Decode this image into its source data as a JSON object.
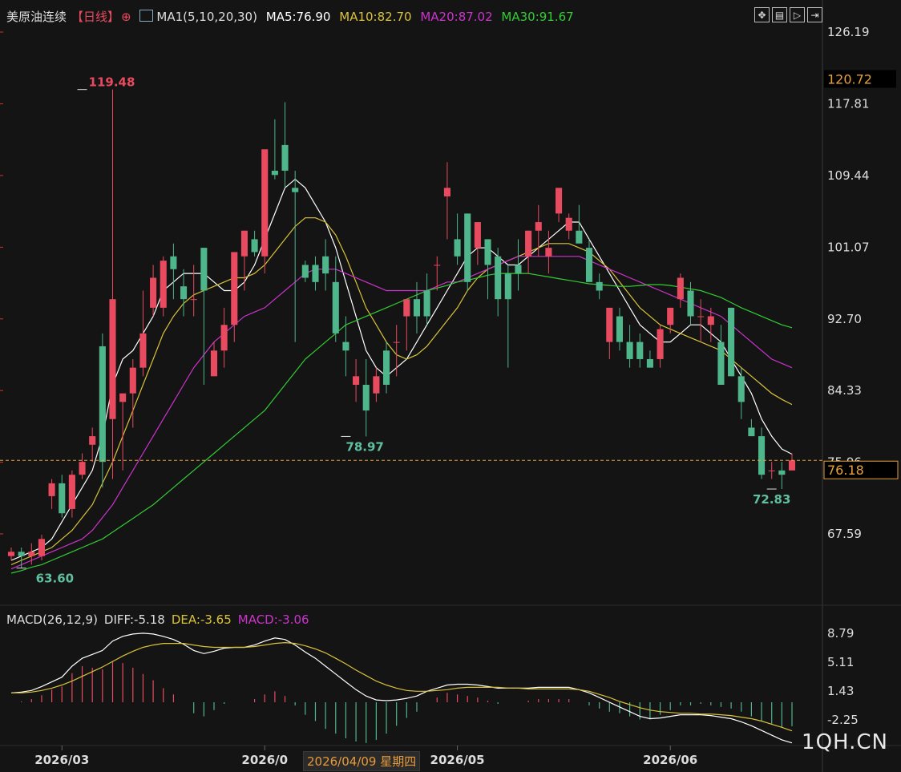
{
  "header": {
    "symbol": "美原油连续",
    "period": "【日线】",
    "ma_label": "MA1(5,10,20,30)",
    "ma5": "MA5:76.90",
    "ma10": "MA10:82.70",
    "ma20": "MA20:87.02",
    "ma30": "MA30:91.67"
  },
  "colors": {
    "background": "#141414",
    "up": "#e84a5f",
    "down": "#4fb58a",
    "ma5": "#ffffff",
    "ma10": "#d9c23a",
    "ma20": "#cc33cc",
    "ma30": "#33cc33",
    "last_price": "#e6a23c"
  },
  "toolbar_icons": [
    "expand-icon",
    "grid-icon",
    "play-icon",
    "next-icon"
  ],
  "macd_header": {
    "label": "MACD(26,12,9)",
    "diff": "DIFF:-5.18",
    "dea": "DEA:-3.65",
    "macd": "MACD:-3.06"
  },
  "cursor_date": "2026/04/09 星期四",
  "watermark": "1QH.CN",
  "chart_data": [
    {
      "type": "candlestick",
      "title": "美原油连续",
      "y_ticks": [
        126.19,
        117.81,
        109.44,
        101.07,
        92.7,
        84.33,
        75.96,
        67.59
      ],
      "ylim": [
        62,
        127
      ],
      "highlighted_prices": {
        "high_marker": "120.72",
        "last_price": "76.18"
      },
      "annotations": [
        {
          "label": "119.48",
          "value": 119.48,
          "index": 7,
          "kind": "high"
        },
        {
          "label": "78.97",
          "value": 78.97,
          "index": 33,
          "kind": "low"
        },
        {
          "label": "63.60",
          "value": 63.6,
          "index": 1,
          "kind": "low"
        },
        {
          "label": "72.83",
          "value": 72.83,
          "index": 75,
          "kind": "low"
        }
      ],
      "x_labels": [
        {
          "label": "2026/03",
          "index": 5
        },
        {
          "label": "2026/0",
          "index": 25
        },
        {
          "label": "2026/05",
          "index": 44
        },
        {
          "label": "2026/06",
          "index": 65
        }
      ],
      "candles": [
        [
          65,
          66,
          64.5,
          65.5
        ],
        [
          65.5,
          66,
          63.6,
          65
        ],
        [
          65,
          66.5,
          64,
          65.5
        ],
        [
          65,
          67.5,
          64.5,
          67
        ],
        [
          72,
          74,
          70.5,
          73.5
        ],
        [
          73.5,
          74.5,
          69.5,
          70
        ],
        [
          70.5,
          75,
          69.5,
          74.5
        ],
        [
          74.5,
          77,
          74,
          76
        ],
        [
          78,
          80,
          76,
          79
        ],
        [
          89.5,
          91,
          73,
          76
        ],
        [
          81,
          119.48,
          74,
          95
        ],
        [
          83,
          83.5,
          75,
          84
        ],
        [
          84,
          88,
          80,
          87
        ],
        [
          87,
          96,
          86,
          91
        ],
        [
          94,
          99,
          93,
          97.5
        ],
        [
          94,
          100,
          93,
          99.5
        ],
        [
          100,
          101.5,
          95,
          98.5
        ],
        [
          96.5,
          98.5,
          93,
          95
        ],
        [
          95,
          99,
          93,
          95
        ],
        [
          101,
          101,
          85,
          96
        ],
        [
          86,
          90,
          86,
          89
        ],
        [
          89,
          94,
          87,
          92
        ],
        [
          92,
          98,
          90,
          100.5
        ],
        [
          100,
          103,
          96,
          103
        ],
        [
          102,
          103,
          100,
          100.5
        ],
        [
          100,
          111,
          98,
          112.5
        ],
        [
          110,
          116,
          109,
          109.5
        ],
        [
          113,
          118,
          108,
          110
        ],
        [
          108,
          110,
          90,
          107.5
        ],
        [
          99,
          99.5,
          97,
          97.5
        ],
        [
          99,
          100,
          96,
          97
        ],
        [
          100,
          102,
          96,
          98
        ],
        [
          97,
          100,
          90,
          91
        ],
        [
          90,
          93,
          86,
          89
        ],
        [
          85,
          88,
          83,
          86
        ],
        [
          85,
          88,
          78.97,
          82
        ],
        [
          84,
          87,
          83,
          86
        ],
        [
          89,
          90,
          84,
          85
        ],
        [
          90,
          92,
          86,
          90
        ],
        [
          93,
          95,
          89,
          95
        ],
        [
          95,
          97,
          91,
          93
        ],
        [
          96,
          98,
          92,
          93
        ],
        [
          99,
          100,
          96,
          99
        ],
        [
          107,
          111,
          102,
          108
        ],
        [
          102,
          105,
          99,
          100
        ],
        [
          105,
          105,
          96,
          97
        ],
        [
          101,
          104,
          99,
          104
        ],
        [
          102,
          102,
          95,
          99
        ],
        [
          100,
          101,
          93,
          95
        ],
        [
          98,
          99,
          87,
          95
        ],
        [
          99,
          102,
          96,
          98
        ],
        [
          100,
          103,
          98,
          103
        ],
        [
          103,
          106,
          100,
          104
        ],
        [
          100,
          103,
          98,
          101
        ],
        [
          105,
          107,
          104,
          108
        ],
        [
          103,
          105,
          102,
          104.5
        ],
        [
          103,
          106,
          102,
          101.5
        ],
        [
          101,
          102,
          98,
          97
        ],
        [
          97,
          98,
          95,
          96
        ],
        [
          90,
          91,
          88,
          94
        ],
        [
          93,
          94,
          89,
          90
        ],
        [
          90,
          92,
          87,
          88
        ],
        [
          90,
          91,
          87,
          88
        ],
        [
          88,
          89,
          87,
          87
        ],
        [
          88,
          92,
          87,
          91.5
        ],
        [
          92,
          94,
          91,
          94
        ],
        [
          95,
          98,
          94,
          97.5
        ],
        [
          96,
          97,
          92,
          93
        ],
        [
          93,
          95,
          90,
          93
        ],
        [
          92,
          94,
          90,
          93
        ],
        [
          90,
          92,
          87,
          85
        ],
        [
          94,
          94,
          86,
          86
        ],
        [
          86,
          87,
          81,
          83
        ],
        [
          80,
          81,
          79,
          79
        ],
        [
          79,
          80,
          74,
          74.5
        ],
        [
          75,
          76,
          74,
          75
        ],
        [
          75,
          76,
          72.83,
          74.5
        ],
        [
          75,
          77,
          75,
          76.18
        ]
      ],
      "ma": {
        "MA5": [
          64.5,
          65,
          65.5,
          66,
          67,
          69,
          71,
          73,
          75,
          79,
          85,
          88,
          89,
          91,
          93,
          96,
          97,
          98,
          98,
          98,
          97,
          96,
          96,
          97,
          99,
          102,
          105,
          108,
          109,
          108,
          106,
          104,
          101,
          97,
          93,
          89,
          87,
          86,
          87,
          88,
          90,
          92,
          94,
          96,
          98,
          100,
          101,
          101,
          100,
          99,
          99,
          100,
          101,
          102,
          103,
          104,
          104,
          102,
          100,
          98,
          96,
          94,
          92,
          91,
          90,
          90,
          91,
          92,
          92,
          91,
          90,
          88,
          86,
          84,
          81,
          79,
          77.5,
          76.9
        ],
        "MA10": [
          64,
          64.5,
          65,
          65.5,
          66,
          67,
          68,
          69.5,
          71,
          73.5,
          76,
          79,
          82,
          85,
          88,
          91,
          93,
          94.5,
          95.5,
          96,
          96.5,
          97,
          97.5,
          97.5,
          98,
          99,
          100.5,
          102,
          103.5,
          104.5,
          104.5,
          104,
          102.5,
          100,
          97,
          94,
          92,
          90,
          88.5,
          88,
          88.5,
          89.5,
          91,
          92.5,
          94,
          96,
          97.5,
          98.5,
          99,
          99.5,
          100,
          100.5,
          101,
          101.5,
          101.5,
          101.5,
          101,
          100.5,
          99.5,
          98.5,
          97,
          95.5,
          94,
          93,
          92,
          91.5,
          91,
          90.5,
          90,
          89.5,
          89,
          88,
          87,
          86,
          85,
          84,
          83.3,
          82.7
        ],
        "MA20": [
          63.5,
          64,
          64.5,
          65,
          65.5,
          66,
          66.5,
          67,
          68,
          69.5,
          71,
          73,
          75,
          77,
          79,
          81,
          83,
          85,
          87,
          88.5,
          90,
          91,
          92,
          93,
          93.5,
          94,
          95,
          96,
          97,
          98,
          98.5,
          98.5,
          98.5,
          98,
          97.5,
          97,
          96.5,
          96,
          96,
          96,
          96,
          96,
          96.5,
          97,
          97,
          97.5,
          98,
          98.5,
          99,
          99.5,
          100,
          100,
          100,
          100,
          100,
          100,
          100,
          99.5,
          99,
          98.5,
          98,
          97.5,
          97,
          96.5,
          96,
          95.5,
          95,
          94.5,
          94,
          93.5,
          93,
          92,
          91,
          90,
          89,
          88,
          87.5,
          87
        ],
        "MA30": [
          63,
          63.3,
          63.7,
          64,
          64.5,
          65,
          65.5,
          66,
          66.5,
          67,
          67.8,
          68.6,
          69.4,
          70.2,
          71,
          72,
          73,
          74,
          75,
          76,
          77,
          78,
          79,
          80,
          81,
          82,
          83.5,
          85,
          86.5,
          88,
          89,
          90,
          91,
          92,
          92.5,
          93,
          93.5,
          94,
          94.5,
          95,
          95.5,
          96,
          96.3,
          96.6,
          97,
          97.2,
          97.5,
          97.8,
          98,
          98,
          98,
          98,
          97.8,
          97.6,
          97.4,
          97.2,
          97,
          96.8,
          96.7,
          96.6,
          96.5,
          96.5,
          96.6,
          96.7,
          96.7,
          96.6,
          96.4,
          96.2,
          96,
          95.6,
          95.2,
          94.6,
          94,
          93.5,
          93,
          92.5,
          92,
          91.67
        ]
      }
    },
    {
      "type": "line",
      "title": "MACD(26,12,9)",
      "y_ticks": [
        8.79,
        5.11,
        1.43,
        -2.25
      ],
      "ylim": [
        -5.5,
        9.5
      ],
      "series": [
        {
          "name": "DIFF",
          "values": [
            1.2,
            1.3,
            1.5,
            2,
            2.6,
            3.2,
            4.6,
            5.6,
            6.1,
            6.6,
            7.8,
            8.4,
            8.7,
            8.8,
            8.7,
            8.4,
            8,
            7.4,
            6.6,
            6.2,
            6.5,
            6.9,
            7,
            7,
            7.3,
            7.8,
            8.2,
            8,
            7.3,
            6.4,
            5.6,
            4.6,
            3.6,
            2.6,
            1.6,
            0.8,
            0.3,
            0.2,
            0.3,
            0.5,
            0.8,
            1.4,
            1.8,
            2.2,
            2.3,
            2.3,
            2.2,
            2,
            1.8,
            1.8,
            1.8,
            1.8,
            1.9,
            1.9,
            1.9,
            1.9,
            1.6,
            1.2,
            0.6,
            0,
            -0.6,
            -1.2,
            -1.8,
            -2.1,
            -2,
            -1.8,
            -1.6,
            -1.6,
            -1.6,
            -1.7,
            -1.9,
            -2.1,
            -2.5,
            -3,
            -3.6,
            -4.2,
            -4.8,
            -5.18
          ]
        },
        {
          "name": "DEA",
          "values": [
            1.2,
            1.2,
            1.3,
            1.5,
            1.8,
            2.2,
            2.7,
            3.3,
            3.9,
            4.5,
            5.2,
            5.9,
            6.5,
            7,
            7.3,
            7.5,
            7.5,
            7.5,
            7.3,
            7.1,
            7,
            7,
            7,
            7,
            7.1,
            7.3,
            7.5,
            7.6,
            7.5,
            7.2,
            6.8,
            6.3,
            5.6,
            4.9,
            4.1,
            3.4,
            2.7,
            2.2,
            1.8,
            1.5,
            1.4,
            1.4,
            1.5,
            1.6,
            1.8,
            1.9,
            1.9,
            1.9,
            1.9,
            1.8,
            1.8,
            1.7,
            1.7,
            1.7,
            1.7,
            1.7,
            1.6,
            1.4,
            1,
            0.6,
            0.1,
            -0.3,
            -0.7,
            -1,
            -1.2,
            -1.3,
            -1.4,
            -1.4,
            -1.5,
            -1.5,
            -1.6,
            -1.7,
            -1.9,
            -2.1,
            -2.4,
            -2.8,
            -3.2,
            -3.65
          ]
        },
        {
          "name": "MACD",
          "values": [
            0,
            0.1,
            0.4,
            0.9,
            1.6,
            2,
            3.7,
            4.6,
            4.4,
            4.2,
            5.2,
            5,
            4.4,
            3.6,
            2.8,
            1.8,
            1,
            0,
            -1.4,
            -1.8,
            -1,
            -0.2,
            0,
            0,
            0.4,
            1,
            1.4,
            0.8,
            -0.4,
            -1.6,
            -2.4,
            -3.4,
            -4,
            -4.6,
            -5,
            -5.2,
            -4.8,
            -4,
            -3,
            -2,
            -1.2,
            0,
            0.6,
            1.2,
            1,
            0.8,
            0.6,
            0.2,
            -0.2,
            0,
            0,
            0.2,
            0.4,
            0.4,
            0.4,
            0.4,
            0,
            -0.4,
            -0.8,
            -1.2,
            -1.4,
            -1.8,
            -2.2,
            -2.2,
            -1.6,
            -1,
            -0.4,
            -0.4,
            -0.2,
            -0.4,
            -0.6,
            -0.8,
            -1.2,
            -1.8,
            -2.4,
            -2.8,
            -3.2,
            -3.06
          ]
        }
      ]
    }
  ]
}
